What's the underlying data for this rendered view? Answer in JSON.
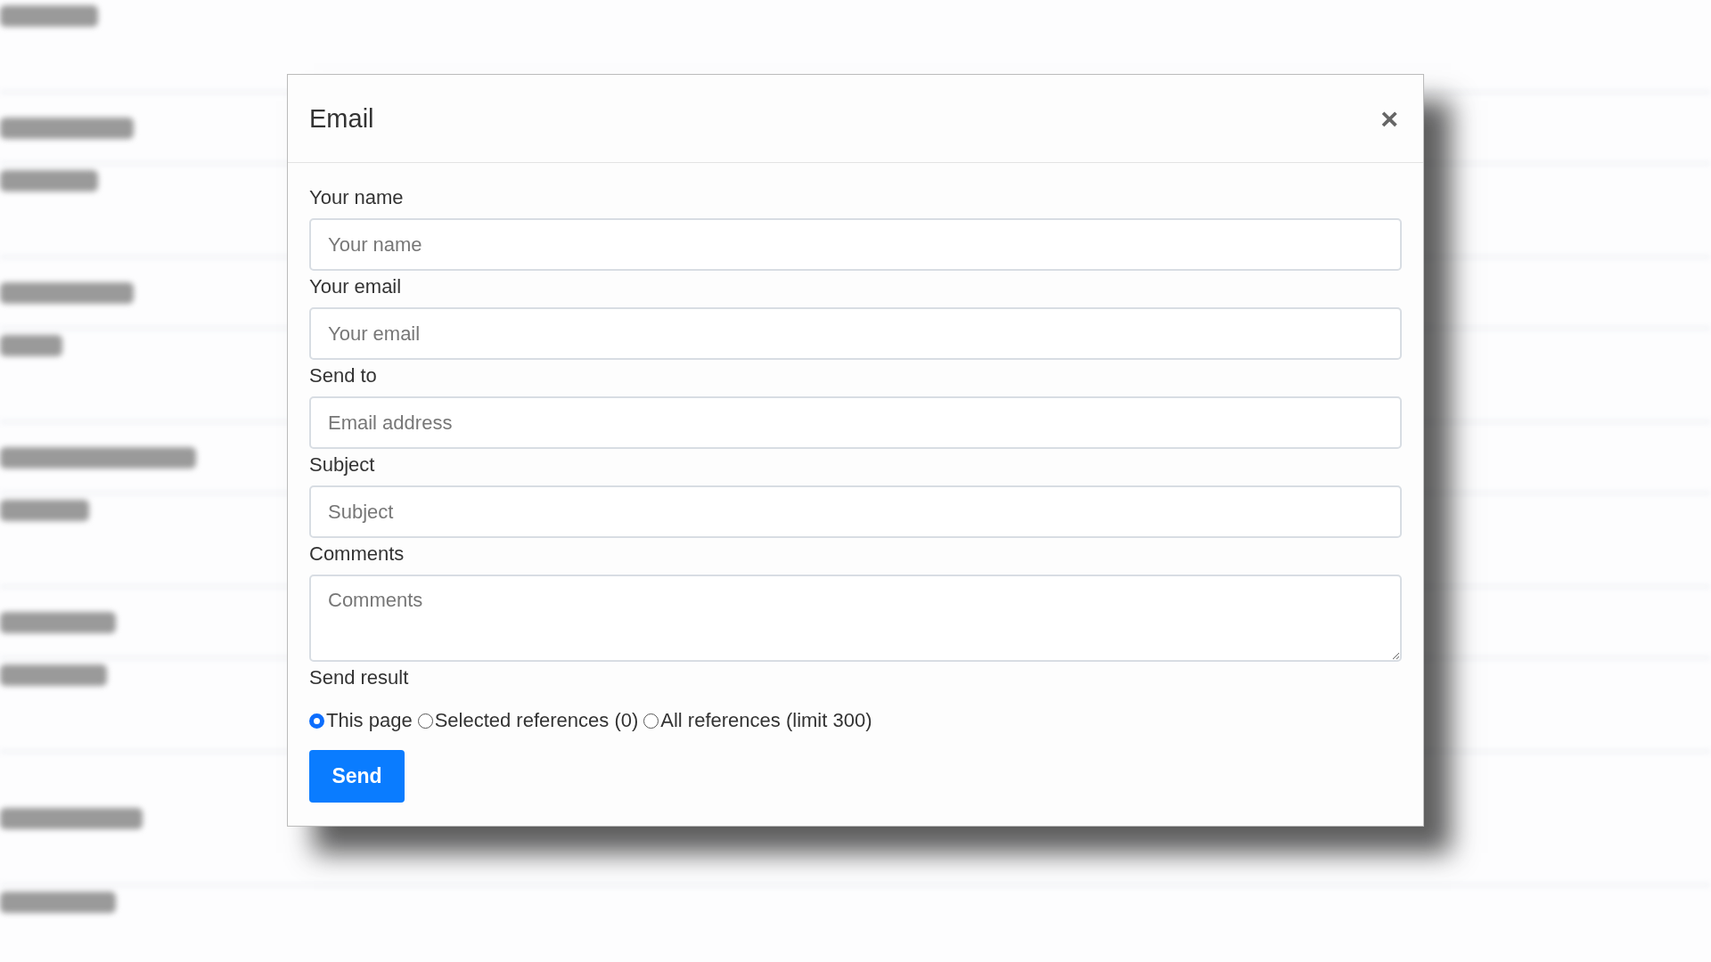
{
  "dialog": {
    "title": "Email",
    "close": "×",
    "fields": [
      {
        "label": "Your name",
        "placeholder": "Your name",
        "kind": "input"
      },
      {
        "label": "Your email",
        "placeholder": "Your email",
        "kind": "input"
      },
      {
        "label": "Send to",
        "placeholder": "Email address",
        "kind": "input"
      },
      {
        "label": "Subject",
        "placeholder": "Subject",
        "kind": "input"
      },
      {
        "label": "Comments",
        "placeholder": "Comments",
        "kind": "textarea"
      }
    ],
    "send_result": {
      "label": "Send result",
      "options": [
        {
          "label": "This page",
          "selected": true
        },
        {
          "label": "Selected references (0)",
          "selected": false
        },
        {
          "label": "All references (limit  300)",
          "selected": false
        }
      ]
    },
    "button": "Send"
  }
}
